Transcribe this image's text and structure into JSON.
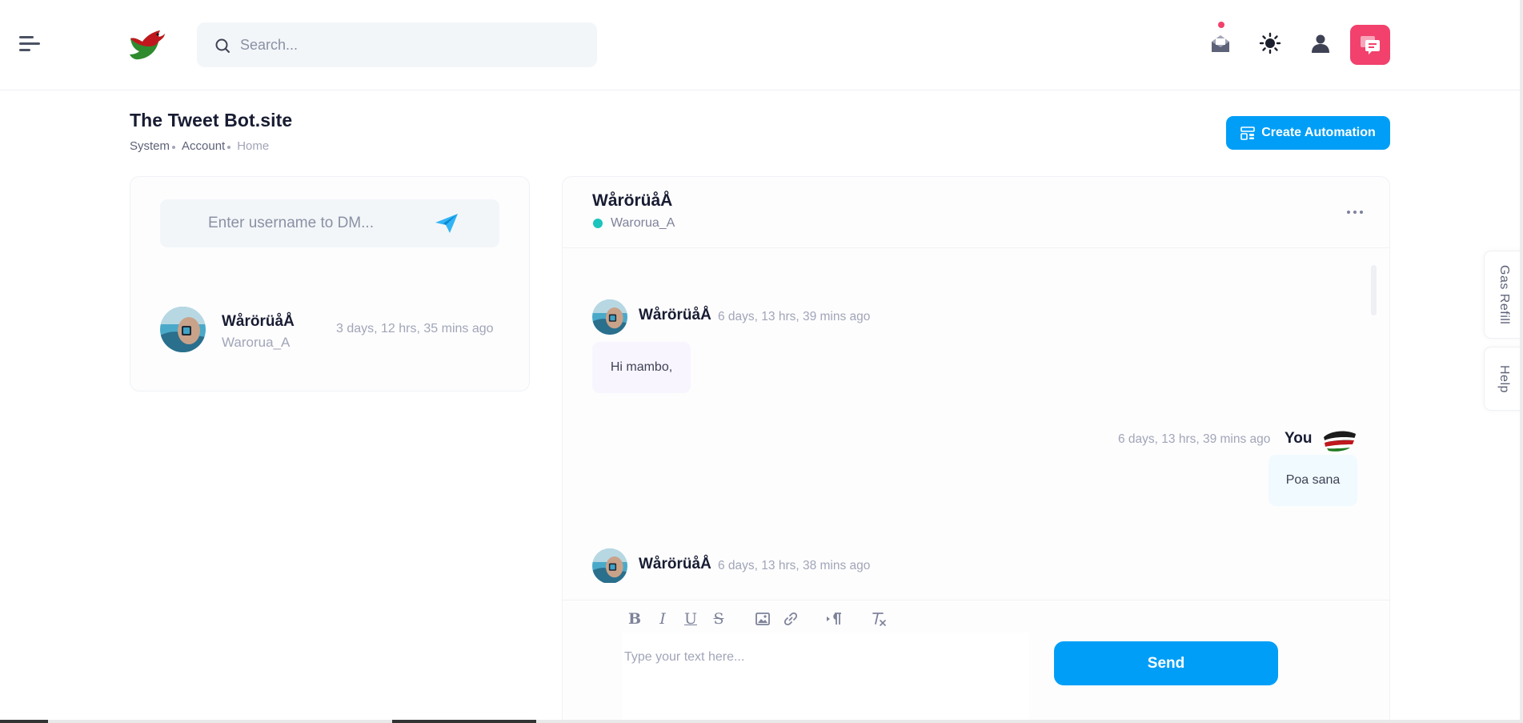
{
  "header": {
    "search_placeholder": "Search...",
    "icons": [
      "menu-icon",
      "logo",
      "search-icon",
      "inbox-icon",
      "sun-icon",
      "user-icon",
      "chat-icon"
    ],
    "notification_color": "#f1416c",
    "chat_button_color": "#f1416c"
  },
  "page": {
    "title": "The Tweet Bot.site",
    "breadcrumb": [
      "System",
      "Account",
      "Home"
    ],
    "create_button": "Create Automation",
    "accent_color": "#009ef7"
  },
  "left_panel": {
    "dm_placeholder": "Enter username to DM...",
    "conversations": [
      {
        "name": "WårörüåÅ",
        "handle": "Warorua_A",
        "time": "3 days, 12 hrs, 35 mins ago"
      }
    ]
  },
  "chat": {
    "contact_name": "WårörüåÅ",
    "contact_handle": "Warorua_A",
    "status_color": "#1bc5bd",
    "messages": [
      {
        "sender": "WårörüåÅ",
        "time": "6 days, 13 hrs, 39 mins ago",
        "text": "Hi mambo,"
      },
      {
        "sender": "You",
        "time": "6 days, 13 hrs, 39 mins ago",
        "text": "Poa sana"
      },
      {
        "sender": "WårörüåÅ",
        "time": "6 days, 13 hrs, 38 mins ago",
        "text": ""
      }
    ],
    "editor": {
      "placeholder": "Type your text here...",
      "toolbar": [
        "bold-icon",
        "italic-icon",
        "underline-icon",
        "strikethrough-icon",
        "image-icon",
        "link-icon",
        "paragraph-direction-icon",
        "clear-format-icon"
      ],
      "send_label": "Send"
    }
  },
  "side_tabs": {
    "gas_refill": "Gas Refill",
    "help": "Help"
  }
}
